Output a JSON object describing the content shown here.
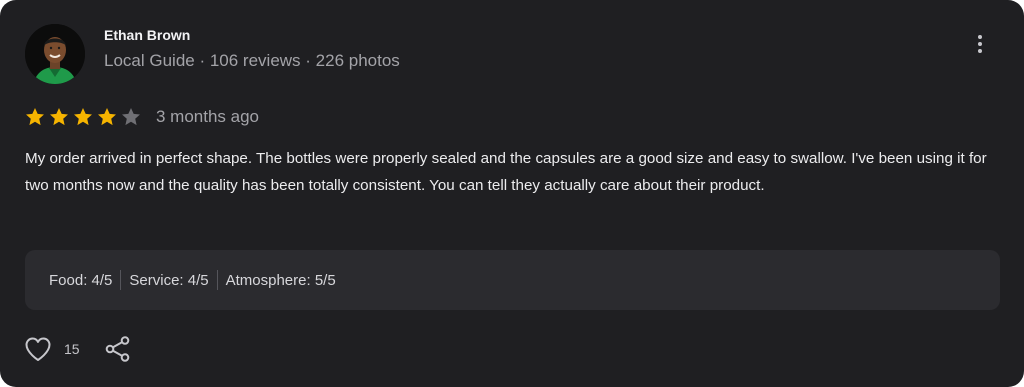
{
  "review": {
    "author_name": "Ethan Brown",
    "author_meta": "Local Guide · 106 reviews · 226 photos",
    "rating": 4,
    "rating_max": 5,
    "time_ago": "3 months ago",
    "text": "My order arrived in perfect shape. The bottles were properly sealed and the capsules are a good size and easy to swallow. I've been using it for two months now and the quality has been totally consistent. You can tell they actually care about their product.",
    "sub_ratings": [
      "Food: 4/5",
      "Service: 4/5",
      "Atmosphere: 5/5"
    ],
    "like_count": "15"
  },
  "icons": {
    "more": "more-vertical-icon",
    "star": "star-icon",
    "like": "heart-icon",
    "share": "share-icon"
  },
  "colors": {
    "card_bg": "#1f1f22",
    "star_filled": "#f6b400",
    "star_empty": "#6f6f74",
    "ratings_bg": "#2b2b2f"
  }
}
